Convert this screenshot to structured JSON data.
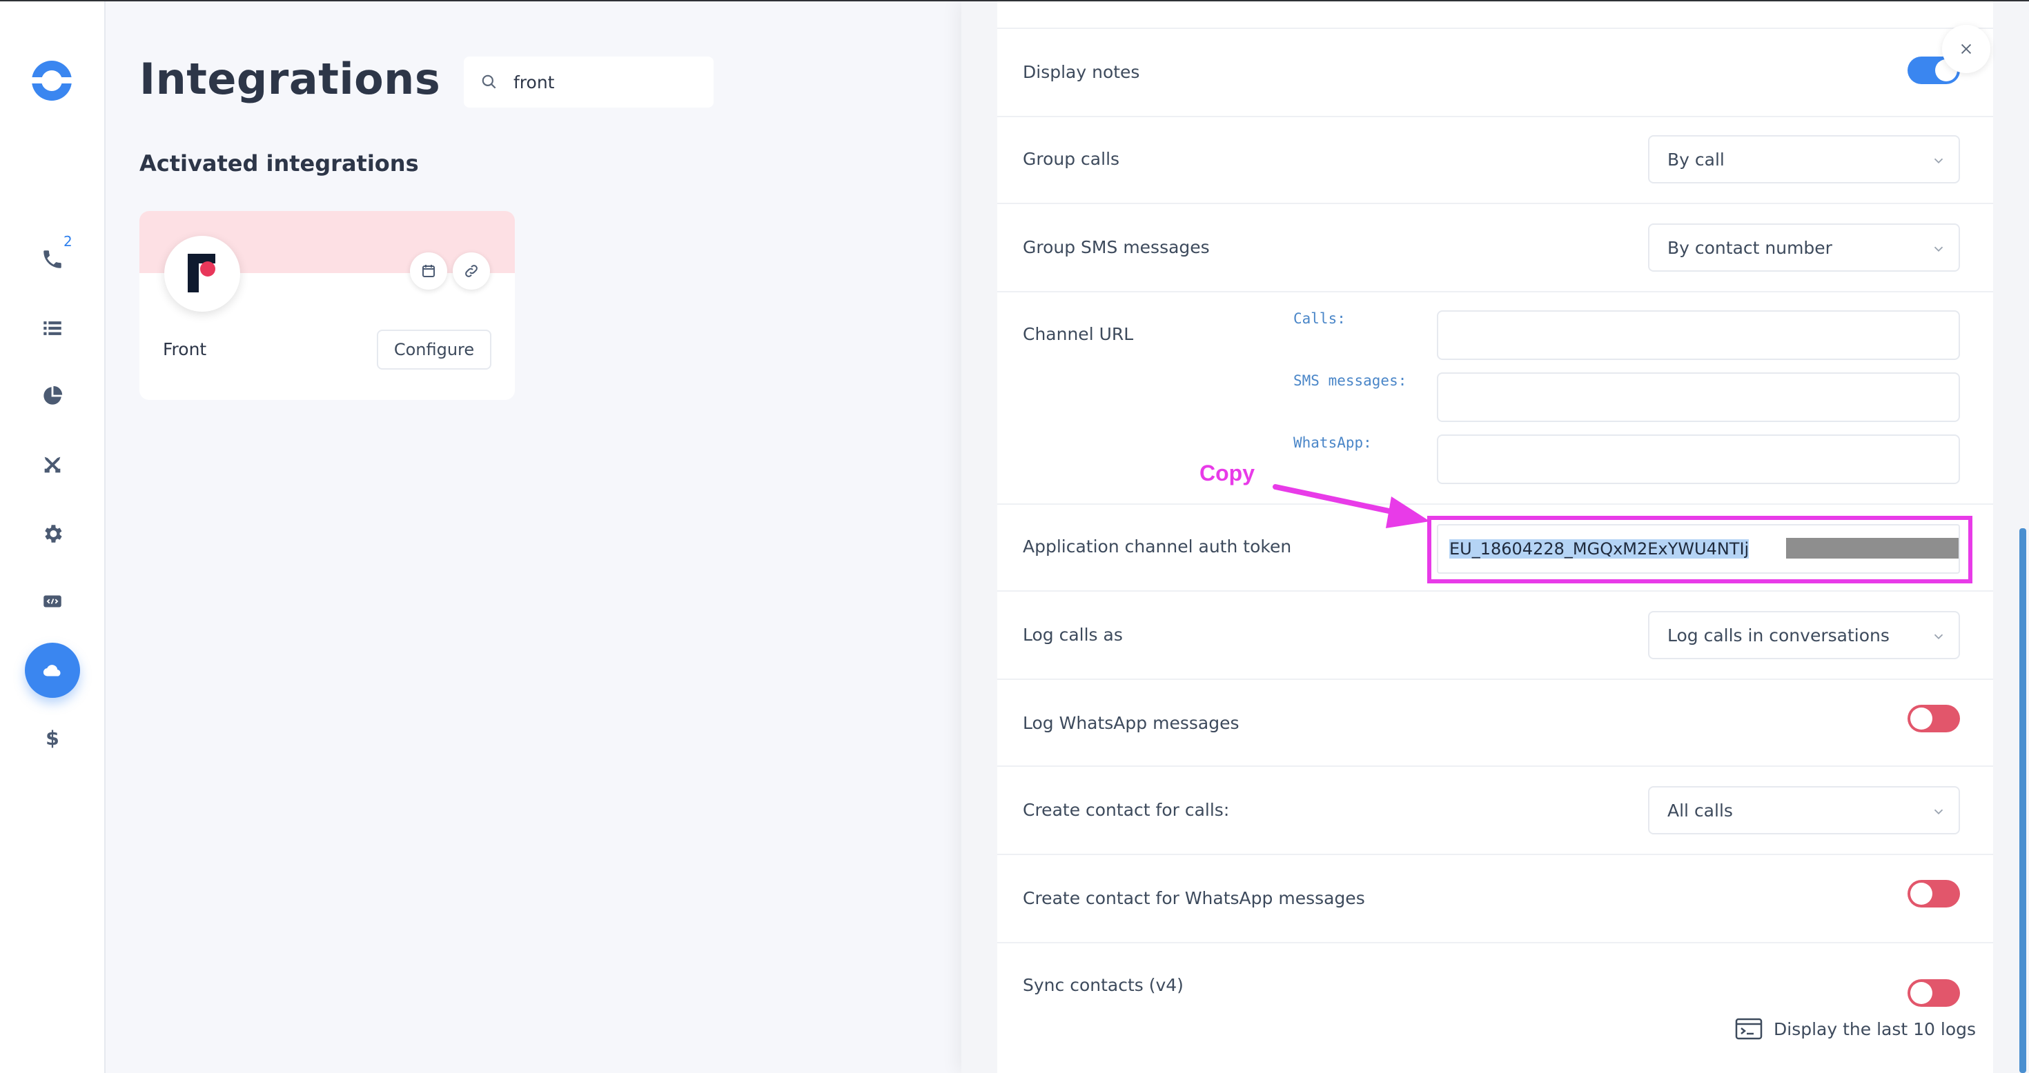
{
  "page": {
    "title": "Integrations",
    "search_value": "front",
    "section_title": "Activated integrations"
  },
  "nav": {
    "items": [
      {
        "icon": "phone-icon",
        "badge": "2"
      },
      {
        "icon": "list-icon"
      },
      {
        "icon": "pie-chart-icon"
      },
      {
        "icon": "tools-icon"
      },
      {
        "icon": "gear-icon"
      },
      {
        "icon": "code-icon"
      },
      {
        "icon": "cloud-icon",
        "active": true
      },
      {
        "icon": "dollar-icon"
      }
    ]
  },
  "card": {
    "name": "Front",
    "configure_label": "Configure"
  },
  "panel": {
    "display_notes_label": "Display notes",
    "group_calls_label": "Group calls",
    "group_calls_value": "By call",
    "group_sms_label": "Group SMS messages",
    "group_sms_value": "By contact number",
    "channel_url_label": "Channel URL",
    "channel_url_calls_label": "Calls:",
    "channel_url_sms_label": "SMS messages:",
    "channel_url_whatsapp_label": "WhatsApp:",
    "auth_token_label": "Application channel auth token",
    "auth_token_value": "EU_18604228_MGQxM2ExYWU4NTIj",
    "log_calls_label": "Log calls as",
    "log_calls_value": "Log calls in conversations",
    "log_whatsapp_label": "Log WhatsApp messages",
    "create_contact_calls_label": "Create contact for calls:",
    "create_contact_calls_value": "All calls",
    "create_contact_whatsapp_label": "Create contact for WhatsApp messages",
    "sync_contacts_label": "Sync contacts (v4)",
    "display_logs_label": "Display the last 10 logs",
    "toggles": {
      "display_notes": true,
      "log_whatsapp": false,
      "create_contact_whatsapp": false,
      "sync_contacts": false
    }
  },
  "annotation": {
    "copy_label": "Copy",
    "color": "#e83be8"
  },
  "colors": {
    "accent": "#3a86f0",
    "toggle_off": "#e2566b",
    "card_banner": "#fde0e4"
  }
}
